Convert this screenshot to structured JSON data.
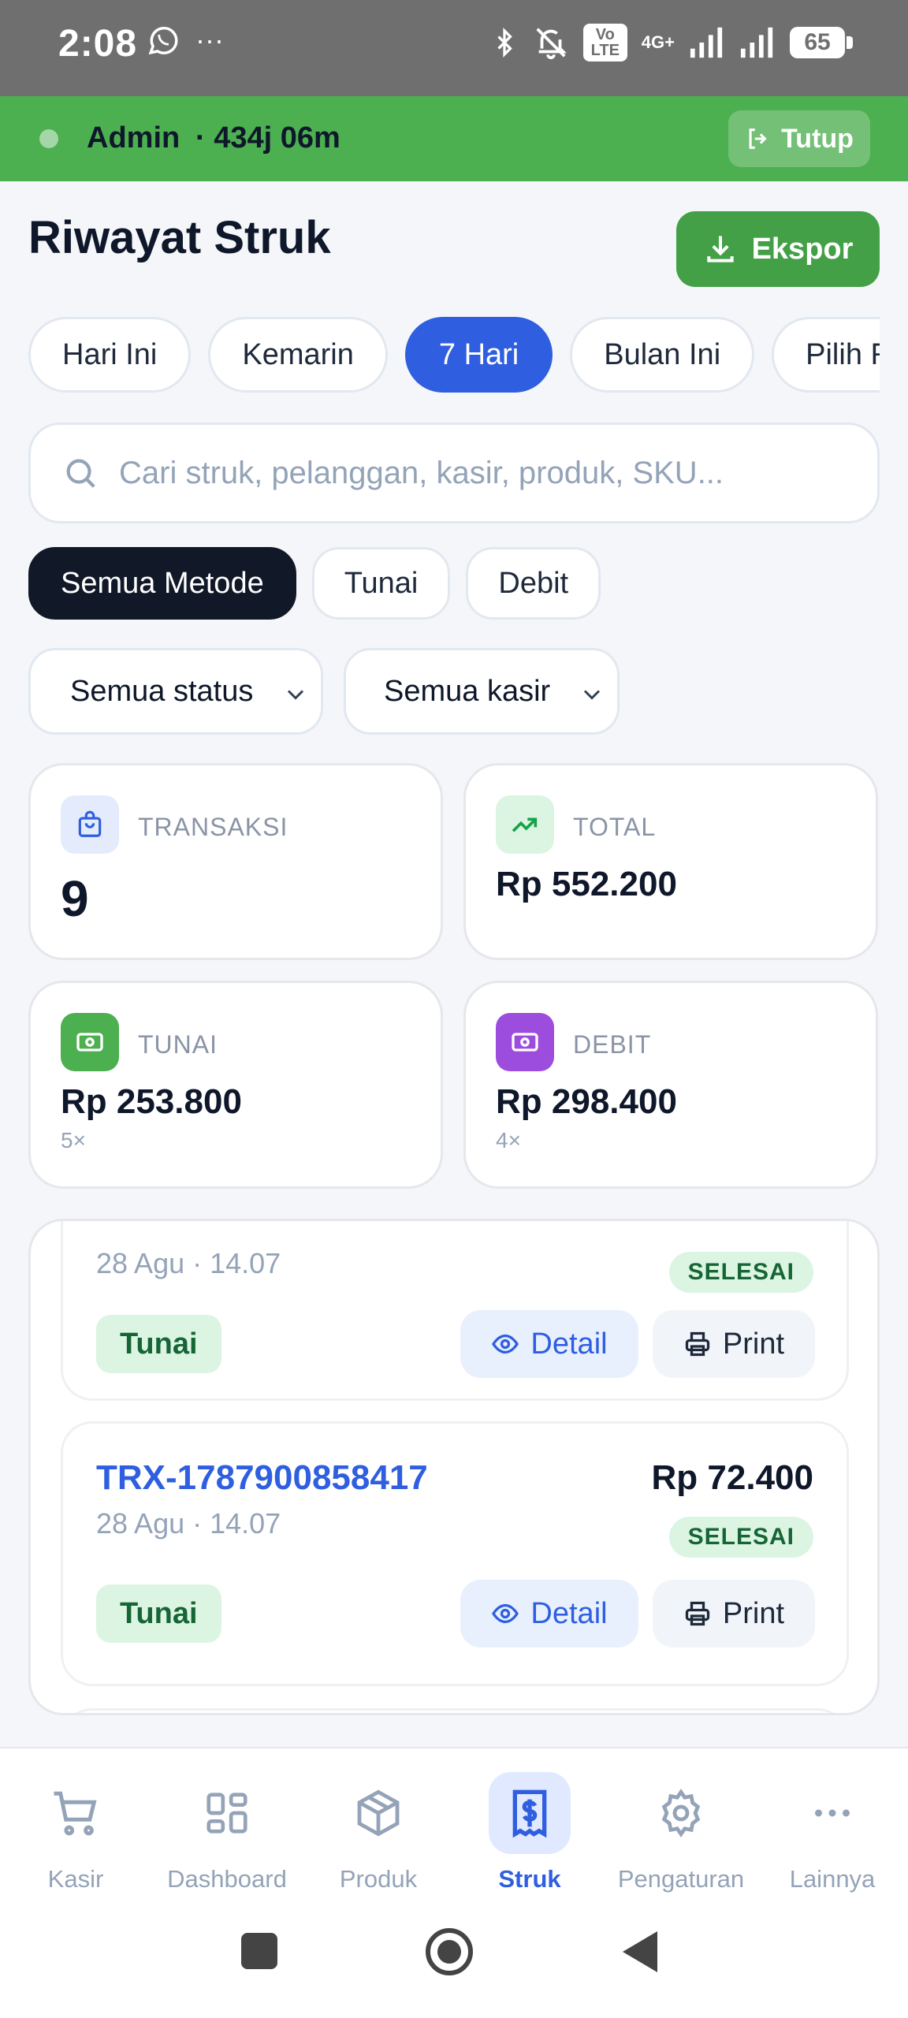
{
  "status_bar": {
    "time": "2:08",
    "left_icons": "whatsapp-icon …",
    "network": "4G+",
    "volte": "Vo LTE",
    "battery": "65"
  },
  "session": {
    "user": "Admin",
    "duration": "· 434j 06m",
    "logout_label": "Tutup"
  },
  "header": {
    "title": "Riwayat Struk",
    "export_label": "Ekspor"
  },
  "date_filters": [
    {
      "label": "Hari Ini",
      "active": false
    },
    {
      "label": "Kemarin",
      "active": false
    },
    {
      "label": "7 Hari",
      "active": true
    },
    {
      "label": "Bulan Ini",
      "active": false
    },
    {
      "label": "Pilih R",
      "active": false
    }
  ],
  "search": {
    "placeholder": "Cari struk, pelanggan, kasir, produk, SKU..."
  },
  "method_filters": [
    {
      "label": "Semua Metode",
      "active": true
    },
    {
      "label": "Tunai",
      "active": false
    },
    {
      "label": "Debit",
      "active": false
    }
  ],
  "selects": {
    "status": "Semua status",
    "cashier": "Semua kasir"
  },
  "stats": {
    "transactions": {
      "label": "TRANSAKSI",
      "value": "9"
    },
    "total": {
      "label": "TOTAL",
      "value": "Rp 552.200"
    },
    "cash": {
      "label": "TUNAI",
      "value": "Rp 253.800",
      "count": "5×"
    },
    "debit": {
      "label": "DEBIT",
      "value": "Rp 298.400",
      "count": "4×"
    }
  },
  "transactions": [
    {
      "id": "",
      "date": "28 Agu · 14.07",
      "amount": "",
      "status": "SELESAI",
      "method": "Tunai",
      "detail_label": "Detail",
      "print_label": "Print"
    },
    {
      "id": "TRX-1787900858417",
      "date": "28 Agu · 14.07",
      "amount": "Rp 72.400",
      "status": "SELESAI",
      "method": "Tunai",
      "detail_label": "Detail",
      "print_label": "Print"
    }
  ],
  "bottom_nav": [
    {
      "label": "Kasir",
      "icon": "cart-icon",
      "active": false
    },
    {
      "label": "Dashboard",
      "icon": "grid-icon",
      "active": false
    },
    {
      "label": "Produk",
      "icon": "box-icon",
      "active": false
    },
    {
      "label": "Struk",
      "icon": "receipt-icon",
      "active": true
    },
    {
      "label": "Pengaturan",
      "icon": "gear-icon",
      "active": false
    },
    {
      "label": "Lainnya",
      "icon": "more-icon",
      "active": false
    }
  ],
  "colors": {
    "session_green": "#4caf50",
    "export_green": "#43a047",
    "primary_blue": "#2f5fe0",
    "dark_chip": "#111827"
  }
}
